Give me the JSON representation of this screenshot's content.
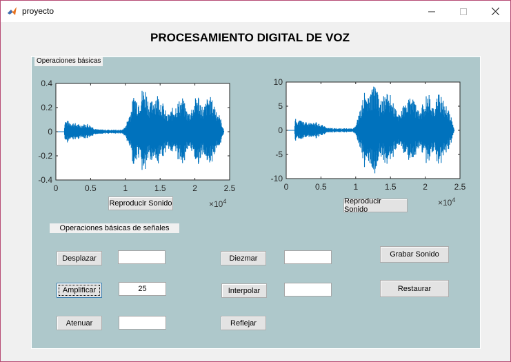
{
  "window": {
    "title": "proyecto",
    "icon": "matlab-icon"
  },
  "main_title": "PROCESAMIENTO DIGITAL DE VOZ",
  "panel": {
    "title": "Operaciones básicas"
  },
  "section_label": "Operaciones básicas de señales",
  "buttons": {
    "reproducir1": "Reproducir Sonido",
    "reproducir2": "Reproducir Sonido",
    "desplazar": "Desplazar",
    "amplificar": "Amplificar",
    "atenuar": "Atenuar",
    "diezmar": "Diezmar",
    "interpolar": "Interpolar",
    "reflejar": "Reflejar",
    "grabar": "Grabar Sonido",
    "restaurar": "Restaurar"
  },
  "fields": {
    "desplazar": "",
    "amplificar": "25",
    "atenuar": "",
    "diezmar": "",
    "interpolar": ""
  },
  "chart_data": [
    {
      "type": "line",
      "color": "#0072bd",
      "xlim": [
        0,
        25000
      ],
      "ylim": [
        -0.4,
        0.4
      ],
      "xticks": [
        "0",
        "0.5",
        "1",
        "1.5",
        "2",
        "2.5"
      ],
      "yticks": [
        "0.4",
        "0.2",
        "0",
        "-0.2",
        "-0.4"
      ],
      "x_exponent": "×10",
      "x_exponent_power": "4"
    },
    {
      "type": "line",
      "color": "#0072bd",
      "xlim": [
        0,
        25000
      ],
      "ylim": [
        -10,
        10
      ],
      "xticks": [
        "0",
        "0.5",
        "1",
        "1.5",
        "2",
        "2.5"
      ],
      "yticks": [
        "10",
        "5",
        "0",
        "-5",
        "-10"
      ],
      "x_exponent": "×10",
      "x_exponent_power": "4"
    }
  ]
}
